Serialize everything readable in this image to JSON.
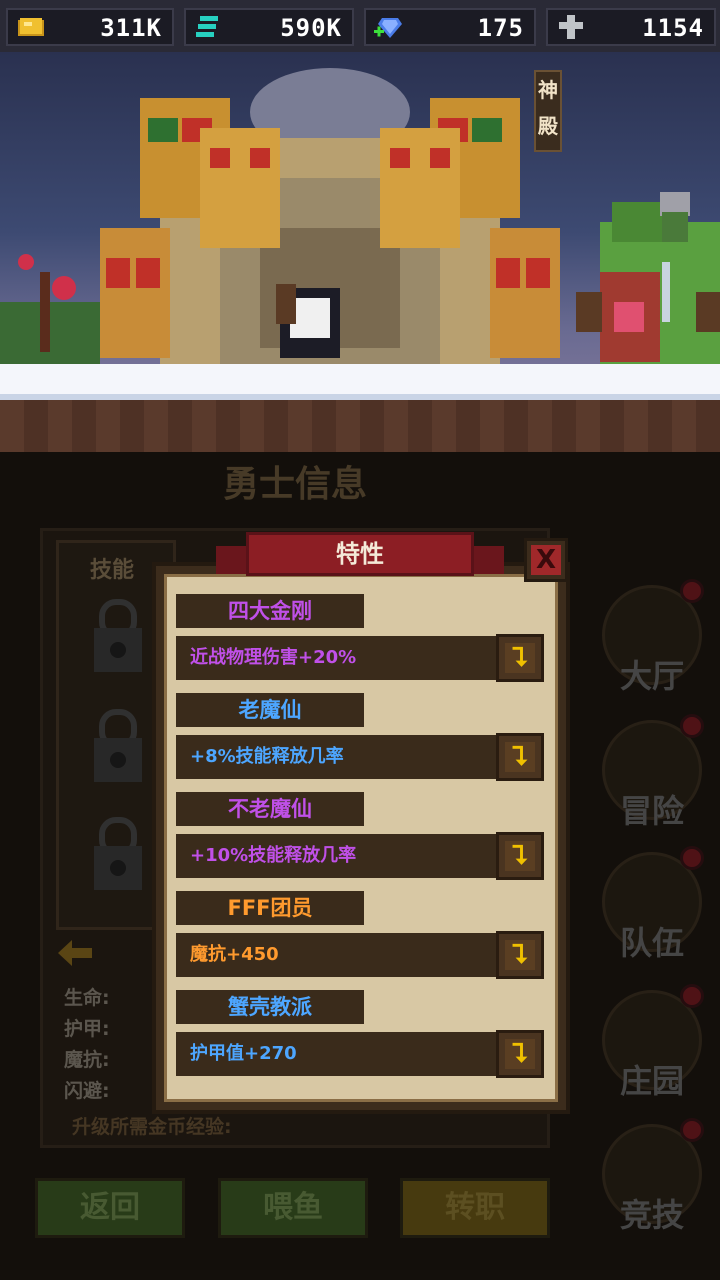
{
  "resources": [
    {
      "icon": "gold-coin-icon",
      "value": "311K"
    },
    {
      "icon": "teal-currency-icon",
      "value": "590K"
    },
    {
      "icon": "blue-gem-icon",
      "value": "175"
    },
    {
      "icon": "cross-icon",
      "value": "1154"
    }
  ],
  "scene": {
    "sign": "神殿"
  },
  "panel": {
    "title": "勇士信息",
    "skill_label": "技能",
    "stats": [
      "生命:",
      "护甲:",
      "魔抗:",
      "闪避:"
    ],
    "upgrade_text": "升级所需金币经验:"
  },
  "buttons": {
    "back": "返回",
    "feed": "喂鱼",
    "job": "转职"
  },
  "nav": [
    {
      "label": "大厅"
    },
    {
      "label": "冒险"
    },
    {
      "label": "队伍"
    },
    {
      "label": "庄园"
    },
    {
      "label": "竞技"
    }
  ],
  "dialog": {
    "title": "特性",
    "close": "X",
    "traits": [
      {
        "name": "四大金刚",
        "name_color": "#c050e8",
        "desc": "近战物理伤害+20%",
        "desc_color": "#c050e8"
      },
      {
        "name": "老魔仙",
        "name_color": "#4da6ff",
        "desc": "+8%技能释放几率",
        "desc_color": "#4da6ff"
      },
      {
        "name": "不老魔仙",
        "name_color": "#c050e8",
        "desc": "+10%技能释放几率",
        "desc_color": "#c050e8"
      },
      {
        "name": "FFF团员",
        "name_color": "#ff9a2e",
        "desc": "魔抗+450",
        "desc_color": "#ff9a2e"
      },
      {
        "name": "蟹壳教派",
        "name_color": "#4da6ff",
        "desc": "护甲值+270",
        "desc_color": "#4da6ff"
      }
    ],
    "trait_button_icon": "upgrade-icon"
  }
}
